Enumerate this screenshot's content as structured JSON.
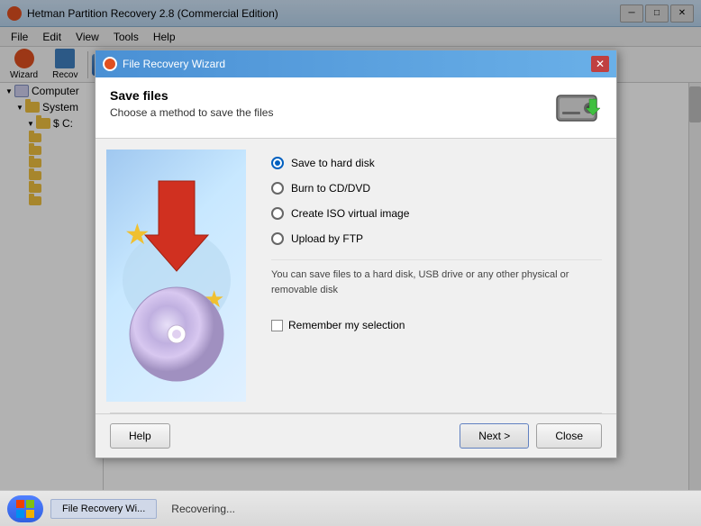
{
  "window": {
    "title": "Hetman Partition Recovery 2.8 (Commercial Edition)",
    "title_icon": "◉"
  },
  "menu": {
    "items": [
      "File",
      "Edit",
      "View",
      "Tools",
      "Help"
    ]
  },
  "toolbar": {
    "wizard_label": "Wizard",
    "recov_label": "Recov"
  },
  "left_panel": {
    "tree": [
      {
        "label": "Computer",
        "indent": 0,
        "expanded": true
      },
      {
        "label": "System",
        "indent": 1,
        "expanded": true
      },
      {
        "label": "$ C:",
        "indent": 2,
        "expanded": true
      }
    ]
  },
  "dialog": {
    "title": "File Recovery Wizard",
    "close_label": "✕",
    "header": {
      "title": "Save files",
      "subtitle": "Choose a method to save the files"
    },
    "options": [
      {
        "id": "hard_disk",
        "label": "Save to hard disk",
        "selected": true
      },
      {
        "id": "cd_dvd",
        "label": "Burn to CD/DVD",
        "selected": false
      },
      {
        "id": "iso",
        "label": "Create ISO virtual image",
        "selected": false
      },
      {
        "id": "ftp",
        "label": "Upload by FTP",
        "selected": false
      }
    ],
    "info_text": "You can save files to a hard disk, USB drive or any other physical or removable disk",
    "remember_label": "Remember my selection",
    "remember_checked": false,
    "buttons": {
      "help": "Help",
      "next": "Next >",
      "close": "Close"
    }
  },
  "taskbar": {
    "status": "Recovering...",
    "taskbar_item": "File Recovery Wi..."
  },
  "colors": {
    "accent": "#3060e0",
    "dialog_title": "#4a90d4",
    "radio_selected": "#0060c0",
    "star": "#f0c030",
    "arrow": "#d03020"
  }
}
